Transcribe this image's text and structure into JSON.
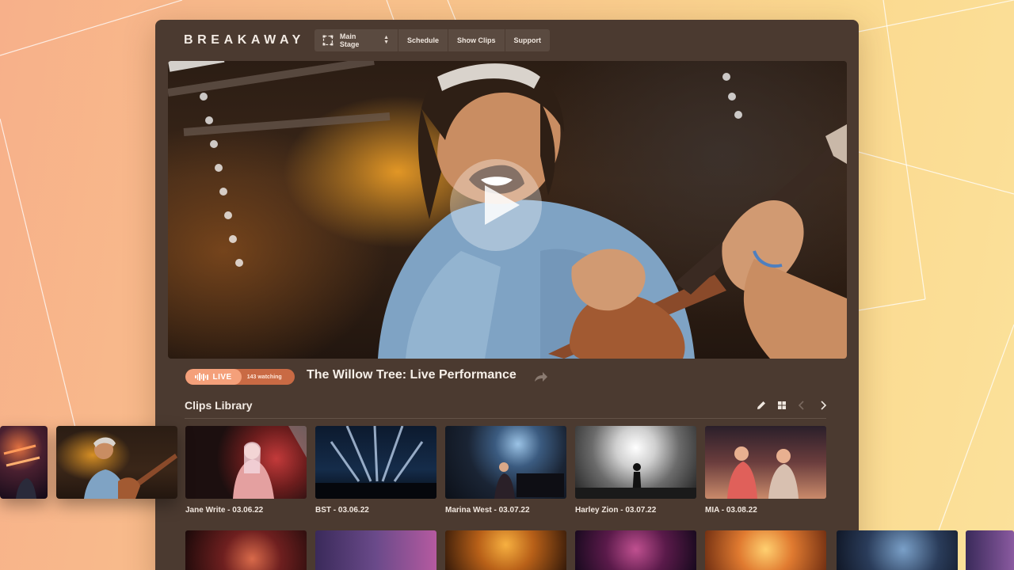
{
  "app": {
    "logo": "BREAKAWAY",
    "nav": {
      "stage_label": "Main Stage",
      "schedule_label": "Schedule",
      "show_clips_label": "Show Clips",
      "support_label": "Support"
    }
  },
  "stream": {
    "live_label": "LIVE",
    "watching": "143 watching",
    "title": "The Willow Tree: Live Performance"
  },
  "clips": {
    "heading": "Clips Library",
    "items": [
      {
        "label": "Jane Write - 03.06.22"
      },
      {
        "label": "BST - 03.06.22"
      },
      {
        "label": "Marina West - 03.07.22"
      },
      {
        "label": "Harley Zion - 03.07.22"
      },
      {
        "label": "MIA - 03.08.22"
      }
    ]
  },
  "colors": {
    "background_start": "#f7b08a",
    "background_end": "#fbe19a",
    "panel": "#4b3a30",
    "live_accent": "#f4a07a",
    "live_pill": "#c96a44"
  },
  "icons": {
    "stage": "stage-icon",
    "share": "share-arrow-icon",
    "edit": "pencil-icon",
    "grid": "grid-icon",
    "prev": "chevron-left-icon",
    "next": "chevron-right-icon",
    "play": "play-icon"
  }
}
